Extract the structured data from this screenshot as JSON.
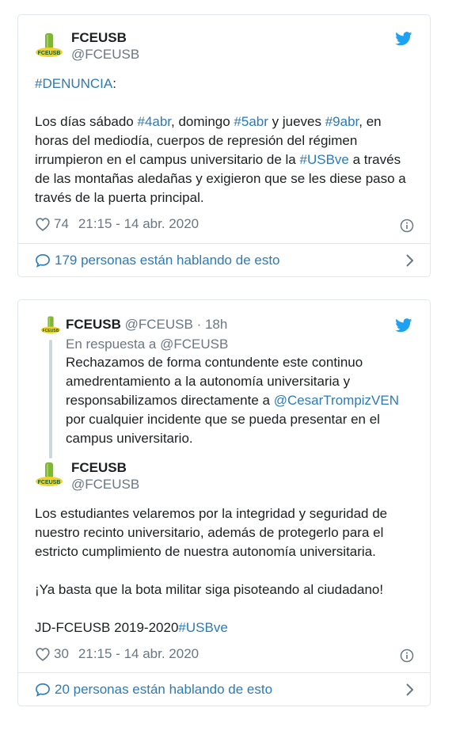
{
  "tweet1": {
    "name": "FCEUSB",
    "handle": "@FCEUSB",
    "hashtag_denuncia": "#DENUNCIA",
    "colon": ":",
    "text_parts": {
      "p1": "Los días sábado ",
      "tag1": "#4abr",
      "p2": ", domingo ",
      "tag2": "#5abr",
      "p3": " y jueves ",
      "tag3": "#9abr",
      "p4": ", en horas del mediodía, cuerpos de represión del régimen irrumpieron en el campus universitario de la ",
      "tag4": "#USBve",
      "p5": " a través de las montañas aledañas y exigieron que se les diese paso a través de la puerta principal."
    },
    "likes": "74",
    "timestamp": "21:15 - 14 abr. 2020",
    "talking": "179 personas están hablando de esto"
  },
  "tweet2": {
    "reply": {
      "name": "FCEUSB",
      "handle": "@FCEUSB",
      "time": "· 18h",
      "in_reply_prefix": "En respuesta a ",
      "in_reply_handle": "@FCEUSB",
      "text_p1": "Rechazamos de forma contundente este continuo amedrentamiento a la autonomía universitaria y responsabilizamos directamente a ",
      "mention": "@CesarTrompizVEN",
      "text_p2": " por cualquier incidente que se pueda presentar en el campus universitario."
    },
    "name": "FCEUSB",
    "handle": "@FCEUSB",
    "para1": "Los estudiantes velaremos por la integridad y seguridad de nuestro recinto universitario, además de protegerlo para el estricto cumplimiento de nuestra autonomía universitaria.",
    "para2": "¡Ya basta que la bota militar siga pisoteando al ciudadano!",
    "sig_prefix": "JD-FCEUSB 2019-2020",
    "sig_tag": "#USBve",
    "likes": "30",
    "timestamp": "21:15 - 14 abr. 2020",
    "talking": "20 personas están hablando de esto"
  },
  "logo_text": "FCEUSB",
  "colors": {
    "link": "#2b7bb9",
    "muted": "#697882",
    "text": "#1c2022",
    "border": "#e1e8ed",
    "twitter": "#1da1f2"
  },
  "icons": [
    "twitter-bird-icon",
    "heart-icon",
    "info-icon",
    "speech-bubble-icon",
    "chevron-right-icon"
  ]
}
